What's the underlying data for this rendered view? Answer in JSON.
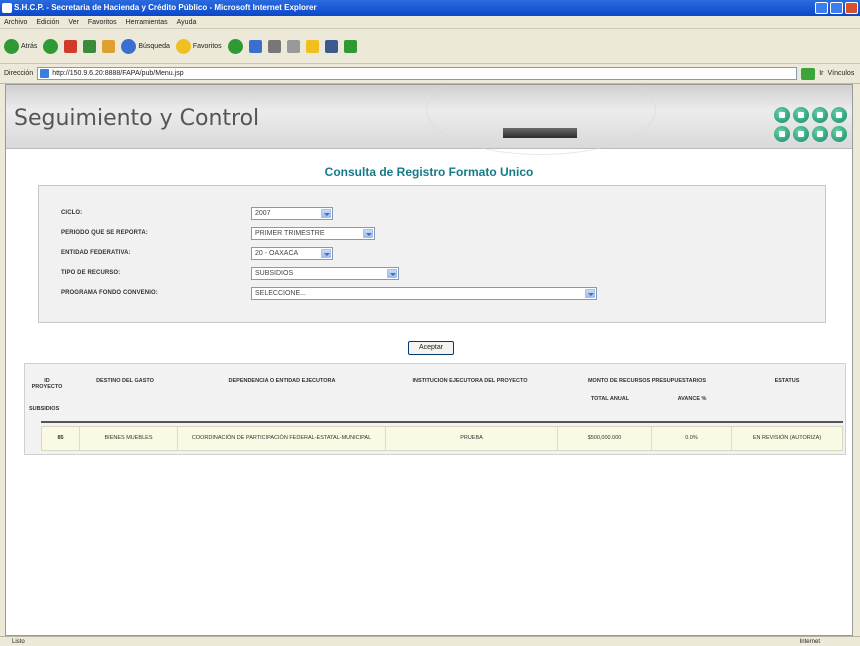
{
  "window": {
    "title": "S.H.C.P. - Secretaria de Hacienda y Crédito Público - Microsoft Internet Explorer"
  },
  "menu": [
    "Archivo",
    "Edición",
    "Ver",
    "Favoritos",
    "Herramientas",
    "Ayuda"
  ],
  "toolbar": {
    "back": "Atrás",
    "search": "Búsqueda",
    "favorites": "Favoritos"
  },
  "address": {
    "label": "Dirección",
    "url": "http://150.9.6.20:8888/FAPA/pub/Menu.jsp",
    "go_label": "Ir",
    "links": "Vínculos"
  },
  "banner": {
    "title": "Seguimiento y Control"
  },
  "page": {
    "heading": "Consulta de Registro Formato Unico"
  },
  "form": {
    "ciclo": {
      "label": "CICLO:",
      "value": "2007"
    },
    "periodo": {
      "label": "PERIODO QUE SE REPORTA:",
      "value": "PRIMER TRIMESTRE"
    },
    "entidad": {
      "label": "ENTIDAD FEDERATIVA:",
      "value": "20 - OAXACA"
    },
    "tipo": {
      "label": "TIPO DE RECURSO:",
      "value": "SUBSIDIOS"
    },
    "programa": {
      "label": "PROGRAMA FONDO CONVENIO:",
      "value": "SELECCIONE..."
    }
  },
  "accept_label": "Aceptar",
  "table": {
    "headers": {
      "id": "ID PROYECTO",
      "destino": "DESTINO DEL GASTO",
      "dependencia": "DEPENDENCIA O ENTIDAD EJECUTORA",
      "institucion": "INSTITUCION EJECUTORA DEL PROYECTO",
      "monto": "MONTO DE RECURSOS PRESUPUESTARIOS",
      "total": "TOTAL ANUAL",
      "avance": "AVANCE %",
      "estatus": "ESTATUS"
    },
    "group": "SUBSIDIOS",
    "rows": [
      {
        "id": "85",
        "destino": "BIENES MUEBLES",
        "dependencia": "COORDINACIÓN DE PARTICIPACIÓN FEDERAL-ESTATAL-MUNICIPAL",
        "institucion": "PRUEBA",
        "total": "$500,000.000",
        "avance": "0.0%",
        "estatus": "EN REVISIÓN (AUTORIZA)"
      }
    ]
  },
  "status": {
    "left": "Listo",
    "right": "Internet"
  },
  "colors": {
    "heading": "#147a8a",
    "titlebar": "#0c47c8",
    "row": "#fafae4"
  }
}
